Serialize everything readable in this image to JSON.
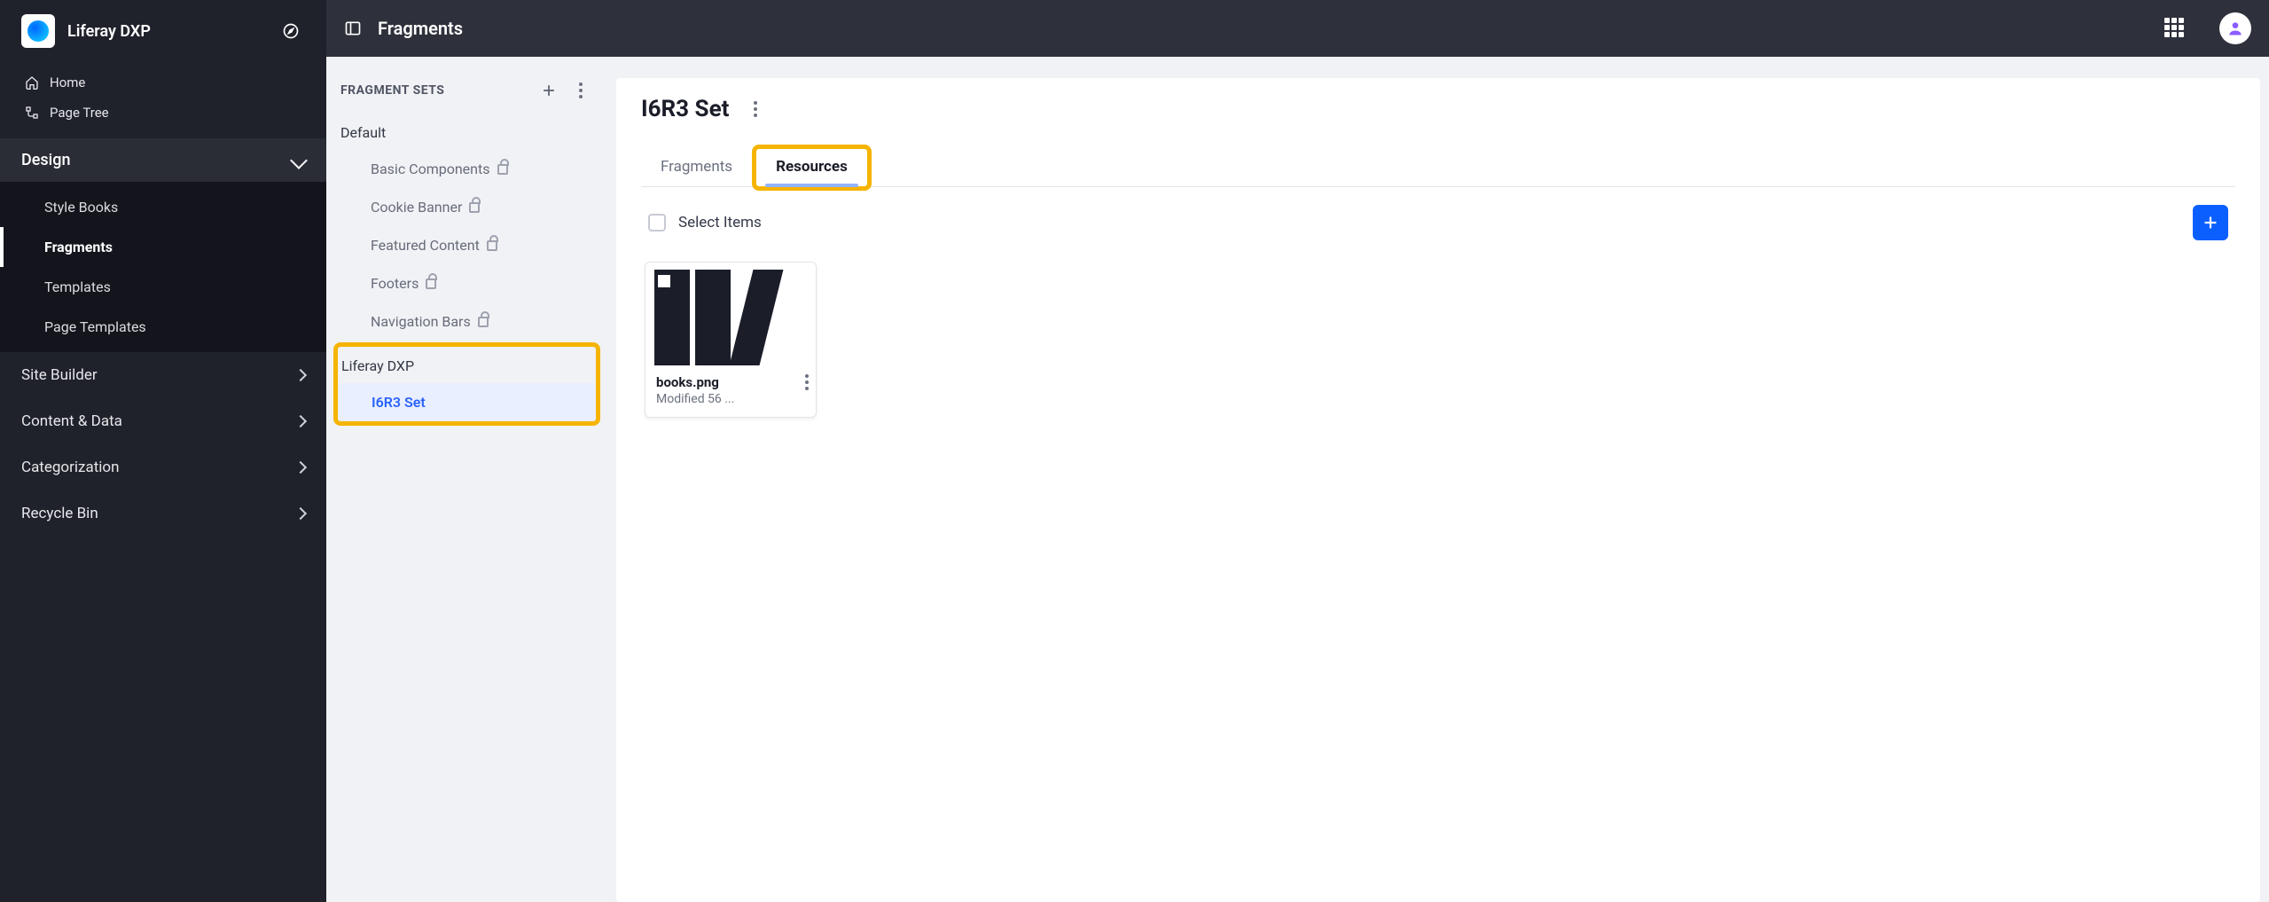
{
  "brand": {
    "title": "Liferay DXP"
  },
  "sidebar": {
    "home": "Home",
    "page_tree": "Page Tree",
    "design": {
      "label": "Design",
      "items": [
        "Style Books",
        "Fragments",
        "Templates",
        "Page Templates"
      ],
      "active_index": 1
    },
    "sections": [
      "Site Builder",
      "Content & Data",
      "Categorization",
      "Recycle Bin"
    ]
  },
  "topbar": {
    "title": "Fragments"
  },
  "setsPanel": {
    "header": "FRAGMENT SETS",
    "groups": [
      {
        "title": "Default",
        "locked": true,
        "items": [
          "Basic Components",
          "Cookie Banner",
          "Featured Content",
          "Footers",
          "Navigation Bars"
        ]
      },
      {
        "title": "Liferay DXP",
        "locked": false,
        "items": [
          "I6R3 Set"
        ],
        "selected": "I6R3 Set",
        "highlight": true
      }
    ]
  },
  "mainPanel": {
    "title": "I6R3 Set",
    "tabs": [
      "Fragments",
      "Resources"
    ],
    "active_tab": 1,
    "select_label": "Select Items",
    "cards": [
      {
        "title": "books.png",
        "meta": "Modified 56 ..."
      }
    ]
  }
}
